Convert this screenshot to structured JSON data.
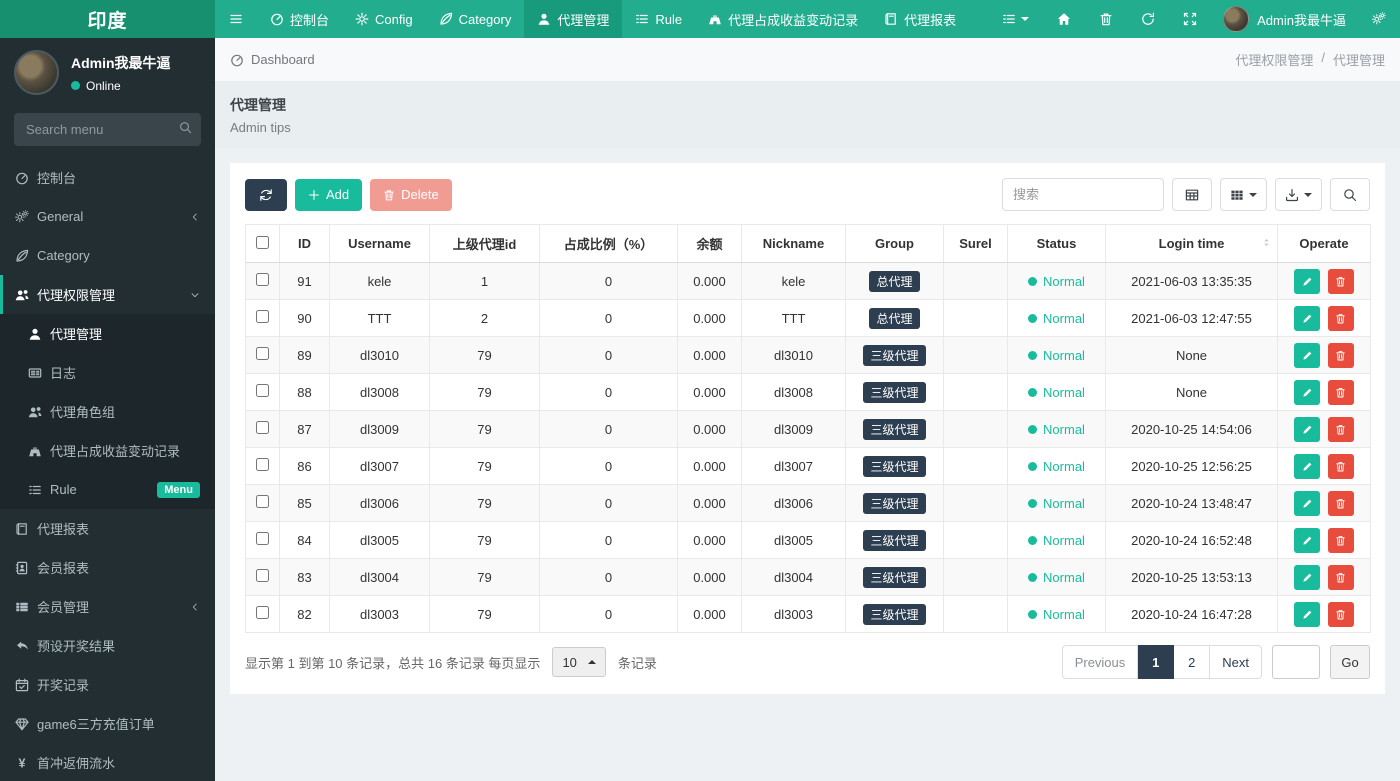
{
  "navbar": {
    "brand": "印度",
    "items": [
      {
        "label": "控制台",
        "icon": "tachometer"
      },
      {
        "label": "Config",
        "icon": "gear"
      },
      {
        "label": "Category",
        "icon": "leaf"
      },
      {
        "label": "代理管理",
        "icon": "user",
        "active": true
      },
      {
        "label": "Rule",
        "icon": "list"
      },
      {
        "label": "代理占成收益变动记录",
        "icon": "binoculars"
      },
      {
        "label": "代理报表",
        "icon": "book"
      }
    ],
    "user_name": "Admin我最牛逼"
  },
  "sidebar": {
    "user_name": "Admin我最牛逼",
    "user_status": "Online",
    "search_placeholder": "Search menu",
    "items": [
      {
        "label": "控制台",
        "icon": "tachometer"
      },
      {
        "label": "General",
        "icon": "cogs"
      },
      {
        "label": "Category",
        "icon": "leaf"
      },
      {
        "label": "代理权限管理",
        "icon": "users",
        "active": true,
        "open": true
      },
      {
        "label": "代理管理",
        "icon": "user",
        "sub": true,
        "active": true
      },
      {
        "label": "日志",
        "icon": "newspaper",
        "sub": true
      },
      {
        "label": "代理角色组",
        "icon": "users",
        "sub": true
      },
      {
        "label": "代理占成收益变动记录",
        "icon": "binoculars",
        "sub": true
      },
      {
        "label": "Rule",
        "icon": "list",
        "sub": true,
        "badge": "Menu"
      },
      {
        "label": "代理报表",
        "icon": "book"
      },
      {
        "label": "会员报表",
        "icon": "address-book"
      },
      {
        "label": "会员管理",
        "icon": "th-list"
      },
      {
        "label": "预设开奖结果",
        "icon": "reply"
      },
      {
        "label": "开奖记录",
        "icon": "calendar-check"
      },
      {
        "label": "game6三方充值订单",
        "icon": "gem"
      },
      {
        "label": "首冲返佣流水",
        "icon": "yen"
      }
    ]
  },
  "breadcrumb": {
    "left": "Dashboard",
    "right_parent": "代理权限管理",
    "separator": "/",
    "right_current": "代理管理"
  },
  "page": {
    "title": "代理管理",
    "subtitle": "Admin tips"
  },
  "toolbar": {
    "add_label": "Add",
    "delete_label": "Delete",
    "search_placeholder": "搜索"
  },
  "table": {
    "columns": [
      "ID",
      "Username",
      "上级代理id",
      "占成比例（%）",
      "余额",
      "Nickname",
      "Group",
      "Surel",
      "Status",
      "Login time",
      "Operate"
    ],
    "rows": [
      {
        "id": "91",
        "username": "kele",
        "parent_id": "1",
        "ratio": "0",
        "balance": "0.000",
        "nickname": "kele",
        "group": "总代理",
        "surel": "",
        "status": "Normal",
        "login_time": "2021-06-03 13:35:35"
      },
      {
        "id": "90",
        "username": "TTT",
        "parent_id": "2",
        "ratio": "0",
        "balance": "0.000",
        "nickname": "TTT",
        "group": "总代理",
        "surel": "",
        "status": "Normal",
        "login_time": "2021-06-03 12:47:55"
      },
      {
        "id": "89",
        "username": "dl3010",
        "parent_id": "79",
        "ratio": "0",
        "balance": "0.000",
        "nickname": "dl3010",
        "group": "三级代理",
        "surel": "",
        "status": "Normal",
        "login_time": "None"
      },
      {
        "id": "88",
        "username": "dl3008",
        "parent_id": "79",
        "ratio": "0",
        "balance": "0.000",
        "nickname": "dl3008",
        "group": "三级代理",
        "surel": "",
        "status": "Normal",
        "login_time": "None"
      },
      {
        "id": "87",
        "username": "dl3009",
        "parent_id": "79",
        "ratio": "0",
        "balance": "0.000",
        "nickname": "dl3009",
        "group": "三级代理",
        "surel": "",
        "status": "Normal",
        "login_time": "2020-10-25 14:54:06"
      },
      {
        "id": "86",
        "username": "dl3007",
        "parent_id": "79",
        "ratio": "0",
        "balance": "0.000",
        "nickname": "dl3007",
        "group": "三级代理",
        "surel": "",
        "status": "Normal",
        "login_time": "2020-10-25 12:56:25"
      },
      {
        "id": "85",
        "username": "dl3006",
        "parent_id": "79",
        "ratio": "0",
        "balance": "0.000",
        "nickname": "dl3006",
        "group": "三级代理",
        "surel": "",
        "status": "Normal",
        "login_time": "2020-10-24 13:48:47"
      },
      {
        "id": "84",
        "username": "dl3005",
        "parent_id": "79",
        "ratio": "0",
        "balance": "0.000",
        "nickname": "dl3005",
        "group": "三级代理",
        "surel": "",
        "status": "Normal",
        "login_time": "2020-10-24 16:52:48"
      },
      {
        "id": "83",
        "username": "dl3004",
        "parent_id": "79",
        "ratio": "0",
        "balance": "0.000",
        "nickname": "dl3004",
        "group": "三级代理",
        "surel": "",
        "status": "Normal",
        "login_time": "2020-10-25 13:53:13"
      },
      {
        "id": "82",
        "username": "dl3003",
        "parent_id": "79",
        "ratio": "0",
        "balance": "0.000",
        "nickname": "dl3003",
        "group": "三级代理",
        "surel": "",
        "status": "Normal",
        "login_time": "2020-10-24 16:47:28"
      }
    ]
  },
  "pagination": {
    "summary_prefix": "显示第 1 到第 10 条记录，总共 16 条记录 每页显示",
    "page_size": "10",
    "summary_suffix": "条记录",
    "prev_label": "Previous",
    "pages": [
      "1",
      "2"
    ],
    "active_page": "1",
    "next_label": "Next",
    "go_label": "Go"
  },
  "colors": {
    "navbar": "#22ad8f",
    "navbar_brand": "#17906f",
    "sidebar": "#232e33",
    "accent": "#18bc9c",
    "dark": "#2c3e50",
    "danger": "#e74c3c"
  }
}
